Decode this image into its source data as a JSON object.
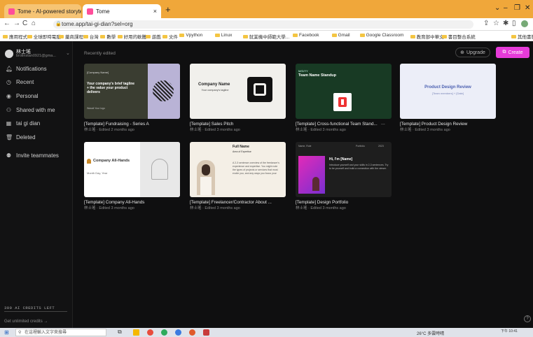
{
  "browser": {
    "tabs": [
      {
        "label": "Tome - AI-powered storytelling"
      },
      {
        "label": "Tome"
      }
    ],
    "new_tab": "+",
    "url": "tome.app/tai-gi-dian?sel=org",
    "bookmarks": [
      "應用程式",
      "全球即時電腦",
      "藥商課程",
      "台灣",
      "數學",
      "好用的軟體",
      "遊戲",
      "文件",
      "Vpython",
      "Linux",
      "就業機中師範大學...",
      "Facebook",
      "Gmail",
      "Google Classroom",
      "教育部中華文",
      "書目整合系統"
    ],
    "other_bookmarks": "其他書籤"
  },
  "sidebar": {
    "user_name": "林士瑤",
    "user_email": "brolinstan0921@gma...",
    "items": [
      {
        "label": "Notifications",
        "icon": "bell-icon"
      },
      {
        "label": "Recent",
        "icon": "clock-icon"
      },
      {
        "label": "Personal",
        "icon": "person-icon"
      },
      {
        "label": "Shared with me",
        "icon": "people-icon"
      },
      {
        "label": "tai gi dian",
        "icon": "workspace-icon"
      },
      {
        "label": "Deleted",
        "icon": "trash-icon"
      },
      {
        "label": "Invite teammates",
        "icon": "add-person-icon"
      }
    ],
    "credits": "300 AI CREDITS LEFT",
    "get_credits": "Get unlimited credits →"
  },
  "header": {
    "section": "Recently edited",
    "upgrade": "Upgrade",
    "create": "Create"
  },
  "cards": [
    {
      "title": "[Template] Fundraising - Series A",
      "meta": "林士瑤 · Edited 2 months ago",
      "thumb": {
        "t1": "[Company Name]",
        "t2": "Your company's brief tagline + the value your product delivers",
        "t3": "Wassit Your logo"
      }
    },
    {
      "title": "[Template] Sales Pitch",
      "meta": "林士瑤 · Edited 3 months ago",
      "thumb": {
        "t1": "Company Name",
        "t2": "Your company's tagline"
      }
    },
    {
      "title": "[Template] Cross-functional Team Stand...",
      "meta": "林士瑤 · Edited 3 months ago",
      "thumb": {
        "t1": "M/D/YY",
        "t2": "Team Name Standup"
      }
    },
    {
      "title": "[Template] Product Design Review",
      "meta": "林士瑤 · Edited 3 months ago",
      "thumb": {
        "t1": "Product Design Review",
        "t2": "[Team members] + [Date]"
      }
    },
    {
      "title": "[Template] Company All-Hands",
      "meta": "林士瑤 · Edited 3 months ago",
      "thumb": {
        "t1": "Company All-Hands",
        "t2": "Month Day, Year"
      }
    },
    {
      "title": "[Template] Freelancer/Contractor About ...",
      "meta": "林士瑤 · Edited 3 months ago",
      "thumb": {
        "t1": "Full Name",
        "t2": "Area of Expertise",
        "t3": "A 2-3 sentence overview of the freelancer's experience and expertise. You might note the types of projects or services that most excite you, and any ways you focus your"
      }
    },
    {
      "title": "[Template] Design Portfolio",
      "meta": "林士瑤 · Edited 3 months ago",
      "thumb": {
        "t1": "Name, Role",
        "t2": "Portfolio",
        "t3": "2023",
        "t4": "Hi, I'm [Name]",
        "t5": "Introduce yourself and your skills in 2-3 sentences. Try to be yourself and build a connection with the viewer."
      }
    }
  ],
  "card_menu": "...",
  "taskbar": {
    "search": "在這裡輸入文字來搜尋",
    "weather": "26°C 多雲時晴",
    "time": "下午 10:41"
  },
  "colors": {
    "accent": "#e63bd9",
    "tabstrip": "#f0a73a",
    "bg": "#0f0f10"
  }
}
